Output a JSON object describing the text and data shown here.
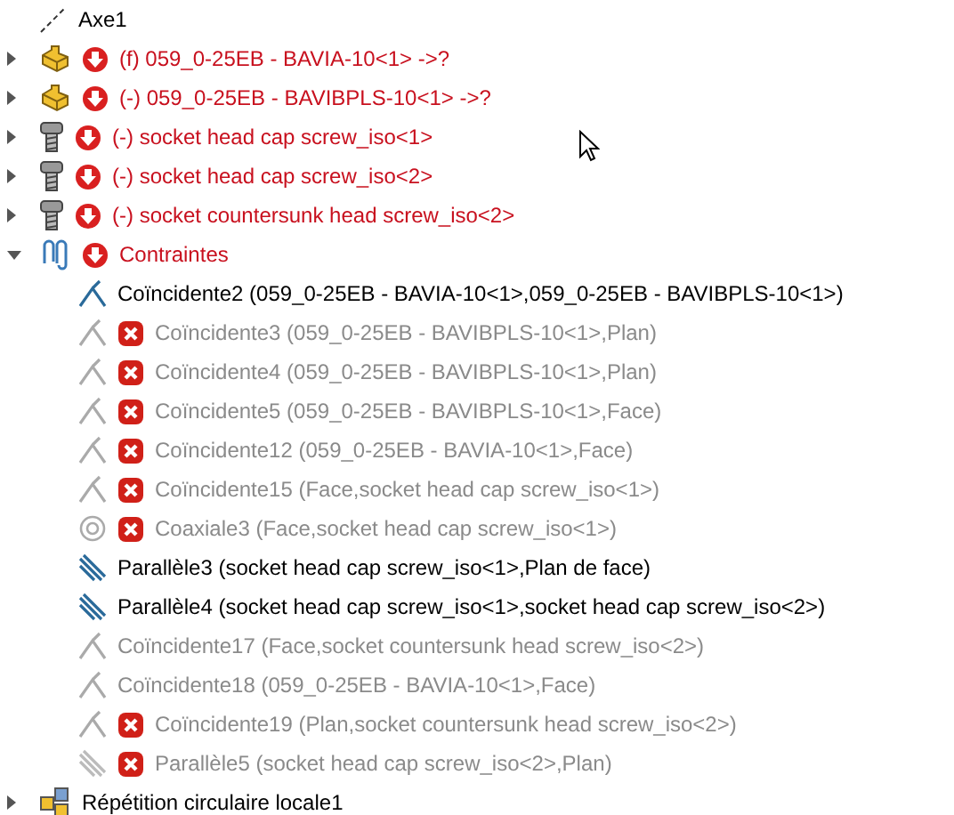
{
  "tree": {
    "items": [
      {
        "label": "Axe1",
        "kind": "axis",
        "error": false
      },
      {
        "label": "(f) 059_0-25EB - BAVIA-10<1> ->?",
        "kind": "part",
        "error": true,
        "expanded": false
      },
      {
        "label": "(-) 059_0-25EB - BAVIBPLS-10<1> ->?",
        "kind": "part",
        "error": true,
        "expanded": false
      },
      {
        "label": "(-) socket head cap screw_iso<1>",
        "kind": "screw",
        "error": true,
        "expanded": false
      },
      {
        "label": "(-) socket head cap screw_iso<2>",
        "kind": "screw",
        "error": true,
        "expanded": false
      },
      {
        "label": "(-) socket countersunk head screw_iso<2>",
        "kind": "screw",
        "error": true,
        "expanded": false
      },
      {
        "label": "Contraintes",
        "kind": "mates",
        "error": true,
        "expanded": true,
        "children": [
          {
            "label": "Coïncidente2 (059_0-25EB - BAVIA-10<1>,059_0-25EB - BAVIBPLS-10<1>)",
            "kind": "coincident",
            "error": false,
            "suppressed": false
          },
          {
            "label": "Coïncidente3 (059_0-25EB - BAVIBPLS-10<1>,Plan)",
            "kind": "coincident",
            "error": true,
            "suppressed": true
          },
          {
            "label": "Coïncidente4 (059_0-25EB - BAVIBPLS-10<1>,Plan)",
            "kind": "coincident",
            "error": true,
            "suppressed": true
          },
          {
            "label": "Coïncidente5 (059_0-25EB - BAVIBPLS-10<1>,Face)",
            "kind": "coincident",
            "error": true,
            "suppressed": true
          },
          {
            "label": "Coïncidente12 (059_0-25EB - BAVIA-10<1>,Face)",
            "kind": "coincident",
            "error": true,
            "suppressed": true
          },
          {
            "label": "Coïncidente15 (Face,socket head cap screw_iso<1>)",
            "kind": "coincident",
            "error": true,
            "suppressed": true
          },
          {
            "label": "Coaxiale3 (Face,socket head cap screw_iso<1>)",
            "kind": "coaxial",
            "error": true,
            "suppressed": true
          },
          {
            "label": "Parallèle3 (socket head cap screw_iso<1>,Plan de face)",
            "kind": "parallel",
            "error": false,
            "suppressed": false
          },
          {
            "label": "Parallèle4 (socket head cap screw_iso<1>,socket head cap screw_iso<2>)",
            "kind": "parallel",
            "error": false,
            "suppressed": false
          },
          {
            "label": "Coïncidente17 (Face,socket countersunk head screw_iso<2>)",
            "kind": "coincident",
            "error": false,
            "suppressed": true
          },
          {
            "label": "Coïncidente18 (059_0-25EB - BAVIA-10<1>,Face)",
            "kind": "coincident",
            "error": false,
            "suppressed": true
          },
          {
            "label": "Coïncidente19 (Plan,socket countersunk head screw_iso<2>)",
            "kind": "coincident",
            "error": true,
            "suppressed": true
          },
          {
            "label": "Parallèle5 (socket head cap screw_iso<2>,Plan)",
            "kind": "parallel",
            "error": true,
            "suppressed": true
          }
        ]
      },
      {
        "label": "Répétition circulaire locale1",
        "kind": "pattern",
        "error": false,
        "expanded": false
      }
    ]
  }
}
